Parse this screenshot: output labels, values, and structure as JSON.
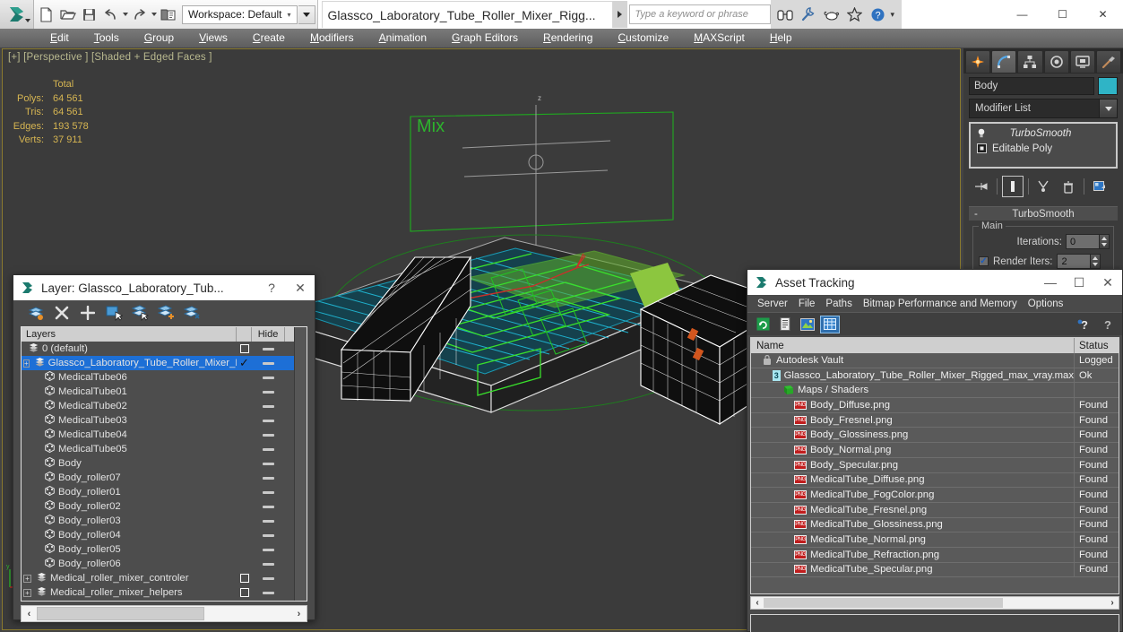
{
  "app": {
    "workspace_label": "Workspace: Default",
    "document_title": "Glassco_Laboratory_Tube_Roller_Mixer_Rigg...",
    "search_placeholder": "Type a keyword or phrase"
  },
  "menubar": {
    "items": [
      "Edit",
      "Tools",
      "Group",
      "Views",
      "Create",
      "Modifiers",
      "Animation",
      "Graph Editors",
      "Rendering",
      "Customize",
      "MAXScript",
      "Help"
    ]
  },
  "viewport": {
    "label": "[+] [Perspective ] [Shaded + Edged Faces ]",
    "stats_header": "Total",
    "stats": [
      {
        "key": "Polys:",
        "value": "64 561"
      },
      {
        "key": "Tris:",
        "value": "64 561"
      },
      {
        "key": "Edges:",
        "value": "193 578"
      },
      {
        "key": "Verts:",
        "value": "37 911"
      }
    ],
    "helper_label": "Mix",
    "axis_label": "z",
    "colors": {
      "background": "#3b3b3b",
      "stats": "#d6b552",
      "helper": "#19b319",
      "selected": "#27d227"
    }
  },
  "command_panel": {
    "tabs": [
      "create-tab",
      "modify-tab",
      "hierarchy-tab",
      "motion-tab",
      "display-tab",
      "utilities-tab"
    ],
    "selected_tab_index": 1,
    "object_name": "Body",
    "object_color": "#2fb4c6",
    "modifier_list_label": "Modifier List",
    "stack": [
      {
        "label": "TurboSmooth",
        "active": true
      },
      {
        "label": "Editable Poly",
        "active": false
      }
    ],
    "rollout": {
      "title": "TurboSmooth",
      "group_label": "Main",
      "iterations_label": "Iterations:",
      "iterations_value": "0",
      "render_iters_label": "Render Iters:",
      "render_iters_value": "2"
    }
  },
  "layer_dialog": {
    "title": "Layer: Glassco_Laboratory_Tub...",
    "toolbar": [
      "create-new-layer-icon",
      "delete-layer-icon",
      "add-layer-icon",
      "select-objects-in-layer-icon",
      "select-highlighted-objects-icon",
      "add-selection-to-layer-icon",
      "select-layer-by-name-icon"
    ],
    "columns": {
      "name": "Layers",
      "hide": "Hide"
    },
    "rows": [
      {
        "name": "0 (default)",
        "indent": 1,
        "icon": "layer-icon",
        "selected": false,
        "checkbox": "box",
        "hide": true
      },
      {
        "name": "Glassco_Laboratory_Tube_Roller_Mixer_Rigged",
        "indent": 1,
        "icon": "layer-icon",
        "selected": true,
        "checkbox": "check",
        "hide": true,
        "expander": true
      },
      {
        "name": "MedicalTube06",
        "indent": 3,
        "icon": "object-icon",
        "selected": false,
        "checkbox": "none",
        "hide": true
      },
      {
        "name": "MedicalTube01",
        "indent": 3,
        "icon": "object-icon",
        "selected": false,
        "checkbox": "none",
        "hide": true
      },
      {
        "name": "MedicalTube02",
        "indent": 3,
        "icon": "object-icon",
        "selected": false,
        "checkbox": "none",
        "hide": true
      },
      {
        "name": "MedicalTube03",
        "indent": 3,
        "icon": "object-icon",
        "selected": false,
        "checkbox": "none",
        "hide": true
      },
      {
        "name": "MedicalTube04",
        "indent": 3,
        "icon": "object-icon",
        "selected": false,
        "checkbox": "none",
        "hide": true
      },
      {
        "name": "MedicalTube05",
        "indent": 3,
        "icon": "object-icon",
        "selected": false,
        "checkbox": "none",
        "hide": true
      },
      {
        "name": "Body",
        "indent": 3,
        "icon": "object-icon",
        "selected": false,
        "checkbox": "none",
        "hide": true
      },
      {
        "name": "Body_roller07",
        "indent": 3,
        "icon": "object-icon",
        "selected": false,
        "checkbox": "none",
        "hide": true
      },
      {
        "name": "Body_roller01",
        "indent": 3,
        "icon": "object-icon",
        "selected": false,
        "checkbox": "none",
        "hide": true
      },
      {
        "name": "Body_roller02",
        "indent": 3,
        "icon": "object-icon",
        "selected": false,
        "checkbox": "none",
        "hide": true
      },
      {
        "name": "Body_roller03",
        "indent": 3,
        "icon": "object-icon",
        "selected": false,
        "checkbox": "none",
        "hide": true
      },
      {
        "name": "Body_roller04",
        "indent": 3,
        "icon": "object-icon",
        "selected": false,
        "checkbox": "none",
        "hide": true
      },
      {
        "name": "Body_roller05",
        "indent": 3,
        "icon": "object-icon",
        "selected": false,
        "checkbox": "none",
        "hide": true
      },
      {
        "name": "Body_roller06",
        "indent": 3,
        "icon": "object-icon",
        "selected": false,
        "checkbox": "none",
        "hide": true
      },
      {
        "name": "Medical_roller_mixer_controler",
        "indent": 1,
        "icon": "layer-icon",
        "selected": false,
        "checkbox": "box",
        "hide": true,
        "expander": true
      },
      {
        "name": "Medical_roller_mixer_helpers",
        "indent": 1,
        "icon": "layer-icon",
        "selected": false,
        "checkbox": "box",
        "hide": true,
        "expander": true
      }
    ]
  },
  "asset_tracking": {
    "title": "Asset Tracking",
    "menu": [
      "Server",
      "File",
      "Paths",
      "Bitmap Performance and Memory",
      "Options"
    ],
    "toolbar": [
      "refresh-icon",
      "list-view-icon",
      "thumbnail-view-icon",
      "grid-view-icon"
    ],
    "toolbar_right": [
      "help-new-icon",
      "help-icon"
    ],
    "columns": {
      "name": "Name",
      "status": "Status"
    },
    "rows": [
      {
        "name": "Autodesk Vault",
        "status": "Logged",
        "indent": 1,
        "icon": "vault-icon"
      },
      {
        "name": "Glassco_Laboratory_Tube_Roller_Mixer_Rigged_max_vray.max",
        "status": "Ok",
        "indent": 2,
        "icon": "max-file-icon"
      },
      {
        "name": "Maps / Shaders",
        "status": "",
        "indent": 3,
        "icon": "maps-shaders-icon"
      },
      {
        "name": "Body_Diffuse.png",
        "status": "Found",
        "indent": 4,
        "icon": "png-icon"
      },
      {
        "name": "Body_Fresnel.png",
        "status": "Found",
        "indent": 4,
        "icon": "png-icon"
      },
      {
        "name": "Body_Glossiness.png",
        "status": "Found",
        "indent": 4,
        "icon": "png-icon"
      },
      {
        "name": "Body_Normal.png",
        "status": "Found",
        "indent": 4,
        "icon": "png-icon"
      },
      {
        "name": "Body_Specular.png",
        "status": "Found",
        "indent": 4,
        "icon": "png-icon"
      },
      {
        "name": "MedicalTube_Diffuse.png",
        "status": "Found",
        "indent": 4,
        "icon": "png-icon"
      },
      {
        "name": "MedicalTube_FogColor.png",
        "status": "Found",
        "indent": 4,
        "icon": "png-icon"
      },
      {
        "name": "MedicalTube_Fresnel.png",
        "status": "Found",
        "indent": 4,
        "icon": "png-icon"
      },
      {
        "name": "MedicalTube_Glossiness.png",
        "status": "Found",
        "indent": 4,
        "icon": "png-icon"
      },
      {
        "name": "MedicalTube_Normal.png",
        "status": "Found",
        "indent": 4,
        "icon": "png-icon"
      },
      {
        "name": "MedicalTube_Refraction.png",
        "status": "Found",
        "indent": 4,
        "icon": "png-icon"
      },
      {
        "name": "MedicalTube_Specular.png",
        "status": "Found",
        "indent": 4,
        "icon": "png-icon"
      }
    ]
  },
  "window_controls": {
    "minimize": "—",
    "maximize": "☐",
    "close": "✕"
  },
  "dialog_controls": {
    "help": "?",
    "close": "✕",
    "minimize": "—",
    "maximize": "☐"
  }
}
